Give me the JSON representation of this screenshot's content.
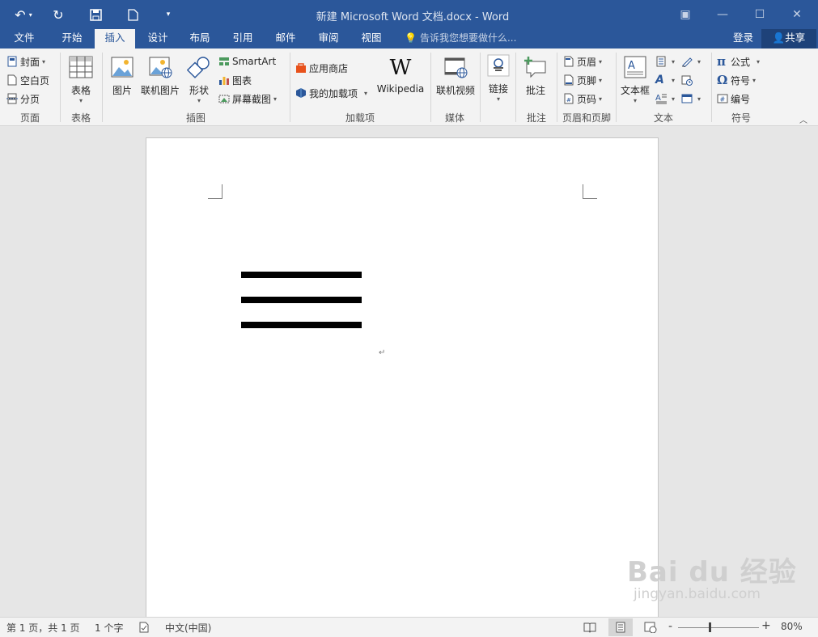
{
  "titlebar": {
    "title": "新建 Microsoft Word 文档.docx - Word",
    "undo_icon": "undo-icon",
    "redo_icon": "redo-icon",
    "save_icon": "save-icon",
    "new_icon": "new-doc-icon",
    "customize_icon": "customize-qat-icon",
    "restore_label": "▣",
    "minimize_label": "—",
    "maximize_label": "☐",
    "close_label": "✕"
  },
  "tabs": [
    "文件",
    "开始",
    "插入",
    "设计",
    "布局",
    "引用",
    "邮件",
    "审阅",
    "视图"
  ],
  "active_tab": "插入",
  "tell_me": "告诉我您想要做什么...",
  "login": "登录",
  "share": "共享",
  "ribbon": {
    "pages": {
      "cover": "封面",
      "blank": "空白页",
      "break": "分页",
      "label": "页面"
    },
    "tables": {
      "table": "表格",
      "label": "表格"
    },
    "illustrations": {
      "picture": "图片",
      "online_picture": "联机图片",
      "shapes": "形状",
      "smartart": "SmartArt",
      "chart": "图表",
      "screenshot": "屏幕截图",
      "label": "插图"
    },
    "addins": {
      "store": "应用商店",
      "my_addins": "我的加载项",
      "wikipedia": "Wikipedia",
      "label": "加载项"
    },
    "media": {
      "online_video": "联机视频",
      "label": "媒体"
    },
    "links": {
      "link": "链接",
      "label": ""
    },
    "comments": {
      "comment": "批注",
      "label": "批注"
    },
    "header_footer": {
      "header": "页眉",
      "footer": "页脚",
      "page_number": "页码",
      "label": "页眉和页脚"
    },
    "text": {
      "textbox": "文本框",
      "label": "文本"
    },
    "symbols": {
      "equation": "公式",
      "symbol": "符号",
      "number": "编号",
      "label": "符号"
    }
  },
  "document": {
    "paragraph_mark": "↵"
  },
  "watermark": {
    "brand": "Bai du 经验",
    "url": "jingyan.baidu.com"
  },
  "statusbar": {
    "page": "第 1 页，共 1 页",
    "words": "1 个字",
    "language": "中文(中国)",
    "zoom_minus": "-",
    "zoom_plus": "+",
    "zoom": "80%"
  },
  "colors": {
    "accent": "#2b579a",
    "ribbon_bg": "#f3f3f3",
    "page_bg": "#ffffff",
    "canvas_bg": "#e6e6e6"
  }
}
